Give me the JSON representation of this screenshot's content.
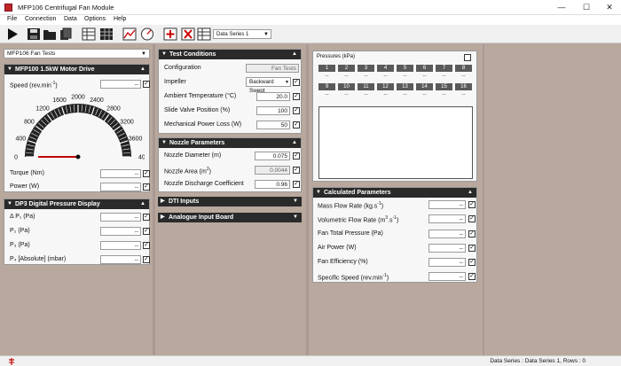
{
  "app": {
    "title": "MFP106 Centrifugal Fan Module",
    "win_min": "—",
    "win_max": "☐",
    "win_close": "✕"
  },
  "menu": [
    "File",
    "Connection",
    "Data",
    "Options",
    "Help"
  ],
  "toolbar": {
    "data_series": "Data Series 1"
  },
  "left": {
    "module_select": "MFP106 Fan Tests",
    "motor": {
      "title": "MFP100 1.5kW Motor Drive",
      "speed_label": "Speed (rev.min",
      "speed_sup": "-1",
      "speed_label_end": ")",
      "speed_value": "--",
      "gauge_ticks": [
        "0",
        "400",
        "800",
        "1200",
        "1600",
        "2000",
        "2400",
        "2800",
        "3200",
        "3600",
        "4000"
      ],
      "torque_label": "Torque (Nm)",
      "torque_value": "--",
      "power_label": "Power (W)",
      "power_value": "--"
    },
    "dp3": {
      "title": "DP3 Digital Pressure Display",
      "rows": [
        {
          "label": "Δ P₁ (Pa)",
          "value": "--"
        },
        {
          "label": "P₂ (Pa)",
          "value": "--"
        },
        {
          "label": "P₃ (Pa)",
          "value": "--"
        },
        {
          "label": "P₄ [Absolute] (mbar)",
          "value": "--"
        }
      ]
    }
  },
  "middle": {
    "test": {
      "title": "Test Conditions",
      "configuration_label": "Configuration",
      "configuration_value": "Fan Tests",
      "impeller_label": "Impeller",
      "impeller_value": "Backward Swept",
      "ambient_label": "Ambient Temperature (°C)",
      "ambient_value": "20.0",
      "slide_label": "Slide Valve Position (%)",
      "slide_value": "100",
      "mech_label": "Mechanical Power Loss (W)",
      "mech_value": "50"
    },
    "nozzle": {
      "title": "Nozzle Parameters",
      "diameter_label": "Nozzle Diameter (m)",
      "diameter_value": "0.075",
      "area_label": "Nozzle Area (m",
      "area_sup": "2",
      "area_label_end": ")",
      "area_value": "0.0044",
      "discharge_label": "Nozzle Discharge Coefficient",
      "discharge_value": "0.96"
    },
    "dti": {
      "title": "DTI Inputs"
    },
    "analogue": {
      "title": "Analogue Input Board"
    }
  },
  "right": {
    "pressures": {
      "title": "Pressures (kPa)",
      "row1": [
        "1",
        "2",
        "3",
        "4",
        "5",
        "6",
        "7",
        "8"
      ],
      "row2": [
        "9",
        "10",
        "11",
        "12",
        "13",
        "14",
        "15",
        "16"
      ],
      "empty": "--"
    },
    "calc": {
      "title": "Calculated Parameters",
      "rows": [
        {
          "label": "Mass Flow Rate (kg.s",
          "sup": "-1",
          "end": ")",
          "value": "--"
        },
        {
          "label": "Volumetric Flow Rate (m",
          "sup": "3",
          "mid": ".s",
          "sup2": "-1",
          "end": ")",
          "value": "--"
        },
        {
          "label": "Fan Total Pressure (Pa)",
          "value": "--"
        },
        {
          "label": "Air Power (W)",
          "value": "--"
        },
        {
          "label": "Fan Efficiency (%)",
          "value": "--"
        },
        {
          "label": "Specific Speed (rev.min",
          "sup": "-1",
          "end": ")",
          "value": "--"
        }
      ]
    }
  },
  "status": {
    "text": "Data Series : Data Series 1,  Rows : 0"
  },
  "colors": {
    "panel_header": "#2a2a2a",
    "background": "#b9a89e",
    "needle": "#c40000"
  }
}
